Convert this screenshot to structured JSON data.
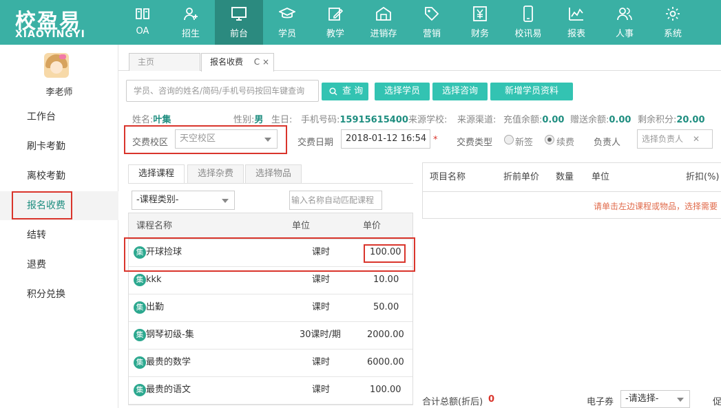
{
  "app": {
    "logo_cn": "校盈易",
    "logo_en": "XIAOYINGYI"
  },
  "nav": [
    {
      "label": "OA",
      "icon": "book-icon"
    },
    {
      "label": "招生",
      "icon": "user-add-icon"
    },
    {
      "label": "前台",
      "icon": "monitor-icon"
    },
    {
      "label": "学员",
      "icon": "graduation-cap-icon"
    },
    {
      "label": "教学",
      "icon": "edit-icon"
    },
    {
      "label": "进销存",
      "icon": "warehouse-icon"
    },
    {
      "label": "营销",
      "icon": "tag-icon"
    },
    {
      "label": "财务",
      "icon": "yen-icon"
    },
    {
      "label": "校讯易",
      "icon": "phone-icon"
    },
    {
      "label": "报表",
      "icon": "chart-icon"
    },
    {
      "label": "人事",
      "icon": "users-icon"
    },
    {
      "label": "系统",
      "icon": "gear-icon"
    }
  ],
  "sidebar": {
    "teacher": "李老师",
    "items": [
      "工作台",
      "刷卡考勤",
      "离校考勤",
      "报名收费",
      "结转",
      "退费",
      "积分兑换"
    ]
  },
  "tabs": {
    "home": "主页",
    "current": "报名收费",
    "current_icons": "C ×"
  },
  "search": {
    "placeholder": "学员、咨询的姓名/简码/手机号码按回车键查询",
    "query_button": "查 询",
    "select_student": "选择学员",
    "select_consult": "选择咨询",
    "add_student": "新增学员资料"
  },
  "info": {
    "name_label": "姓名:",
    "name": "叶集",
    "gender_label": "性别:",
    "gender": "男",
    "birthday_label": "生日:",
    "phone_label": "手机号码:",
    "phone": "15915615400",
    "source_school_label": "来源学校:",
    "source_channel_label": "来源渠道:",
    "recharge_label": "充值余额:",
    "recharge": "0.00",
    "gift_label": "赠送余额:",
    "gift": "0.00",
    "points_label": "剩余积分:",
    "points": "20.00"
  },
  "form": {
    "campus_label": "交费校区",
    "campus_value": "天空校区",
    "date_label": "交费日期",
    "date_value": "2018-01-12 16:54",
    "required_mark": "*",
    "type_label": "交费类型",
    "type_new": "新签",
    "type_renew": "续费",
    "owner_label": "负责人",
    "owner_placeholder": "选择负责人",
    "owner_clear": "✕"
  },
  "course_panel": {
    "tabs": [
      "选择课程",
      "选择杂费",
      "选择物品"
    ],
    "category": "-课程类别-",
    "match_placeholder": "输入名称自动匹配课程",
    "headers": {
      "name": "课程名称",
      "unit": "单位",
      "price": "单价"
    },
    "badge": "集",
    "rows": [
      {
        "name": "开球捡球",
        "unit": "课时",
        "price": "100.00"
      },
      {
        "name": "kkk",
        "unit": "课时",
        "price": "10.00"
      },
      {
        "name": "出勤",
        "unit": "课时",
        "price": "50.00"
      },
      {
        "name": "钢琴初级-集",
        "unit": "30课时/期",
        "price": "2000.00"
      },
      {
        "name": "最贵的数学",
        "unit": "课时",
        "price": "6000.00"
      },
      {
        "name": "最贵的语文",
        "unit": "课时",
        "price": "100.00"
      }
    ]
  },
  "item_panel": {
    "headers": {
      "name": "项目名称",
      "orig_price": "折前单价",
      "qty": "数量",
      "unit": "单位",
      "discount": "折扣(%)"
    },
    "hint": "请单击左边课程或物品，选择需要"
  },
  "footer": {
    "total_label": "合计总额(折后)",
    "total_value": "0",
    "coupon_label": "电子券",
    "coupon_select": "-请选择-",
    "promo_cut": "促"
  },
  "colors": {
    "brand": "#3ab0a4",
    "nav_active": "#2b8a7f",
    "button": "#33c3b2",
    "highlight": "#d9342b"
  }
}
